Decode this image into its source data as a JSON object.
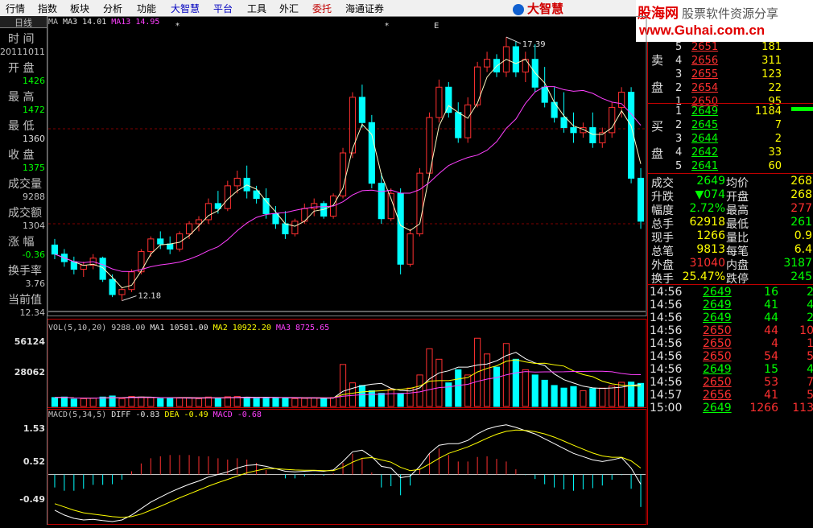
{
  "menu": {
    "items": [
      "行情",
      "指数",
      "板块",
      "分析",
      "功能",
      "大智慧",
      "平台",
      "工具",
      "外汇",
      "委托",
      "海通证券"
    ],
    "logo_text": "大智慧"
  },
  "watermark": {
    "line1_brand": "股海网",
    "line1_slogan": "股票软件资源分享",
    "line2": "www.Guhai.com.cn"
  },
  "left_panel": {
    "tab": "日线",
    "rows": [
      {
        "label": "时  间",
        "value": "20111011",
        "color": "#c0c0c0"
      },
      {
        "label": "开  盘",
        "value": "1426",
        "color": "#00ff00"
      },
      {
        "label": "最  高",
        "value": "1472",
        "color": "#00ff00"
      },
      {
        "label": "最  低",
        "value": "1360",
        "color": "#e0e0e0"
      },
      {
        "label": "收  盘",
        "value": "1375",
        "color": "#00ff00"
      },
      {
        "label": "成交量",
        "value": "9288",
        "color": "#c0c0c0"
      },
      {
        "label": "成交额",
        "value": "1304",
        "color": "#c0c0c0"
      },
      {
        "label": "涨  幅",
        "value": "-0.36",
        "color": "#00ff00"
      },
      {
        "label": "换手率",
        "value": "3.76",
        "color": "#c0c0c0"
      },
      {
        "label": "当前值",
        "value": "12.34",
        "color": "#c0c0c0"
      }
    ]
  },
  "price_chart": {
    "legend": [
      {
        "text": "MA",
        "color": "#c0c0c0"
      },
      {
        "text": "MA3 14.01",
        "color": "#e0e0e0"
      },
      {
        "text": "MA13 14.95",
        "color": "#ff40ff"
      }
    ],
    "high_label": "17.39",
    "low_label": "12.18",
    "markers": [
      "*",
      "*",
      "E"
    ]
  },
  "volume_chart": {
    "legend": [
      {
        "text": "VOL(5,10,20)",
        "color": "#c0c0c0"
      },
      {
        "text": "9288.00",
        "color": "#c0c0c0"
      },
      {
        "text": "MA1 10581.00",
        "color": "#e0e0e0"
      },
      {
        "text": "MA2 10922.20",
        "color": "#ffff00"
      },
      {
        "text": "MA3 8725.65",
        "color": "#ff40ff"
      }
    ],
    "y_ticks": [
      "56124",
      "28062"
    ]
  },
  "macd_chart": {
    "legend": [
      {
        "text": "MACD(5,34,5)",
        "color": "#c0c0c0"
      },
      {
        "text": "DIFF -0.83",
        "color": "#e0e0e0"
      },
      {
        "text": "DEA -0.49",
        "color": "#ffff00"
      },
      {
        "text": "MACD -0.68",
        "color": "#ff40ff"
      }
    ],
    "y_ticks": [
      "1.53",
      "0.52",
      "-0.49"
    ]
  },
  "order_book": {
    "sell_label": [
      "卖",
      "盘"
    ],
    "buy_label": [
      "买",
      "盘"
    ],
    "sell": [
      {
        "level": "5",
        "price": "2651",
        "volume": "181"
      },
      {
        "level": "4",
        "price": "2656",
        "volume": "311"
      },
      {
        "level": "3",
        "price": "2655",
        "volume": "123"
      },
      {
        "level": "2",
        "price": "2654",
        "volume": "22"
      },
      {
        "level": "1",
        "price": "2650",
        "volume": "95"
      }
    ],
    "buy": [
      {
        "level": "1",
        "price": "2649",
        "volume": "1184"
      },
      {
        "level": "2",
        "price": "2645",
        "volume": "7"
      },
      {
        "level": "3",
        "price": "2644",
        "volume": "2"
      },
      {
        "level": "4",
        "price": "2642",
        "volume": "33"
      },
      {
        "level": "5",
        "price": "2641",
        "volume": "60"
      }
    ]
  },
  "stats": [
    {
      "l1": "成交",
      "v1": "2649",
      "v1c": "#00ff00",
      "l2": "均价",
      "v2": "268",
      "v2c": "#ffff00"
    },
    {
      "l1": "升跌",
      "v1": "▼074",
      "v1c": "#00ff00",
      "l2": "开盘",
      "v2": "268",
      "v2c": "#ffff00"
    },
    {
      "l1": "幅度",
      "v1": "2.72%",
      "v1c": "#00ff00",
      "l2": "最高",
      "v2": "277",
      "v2c": "#ff3030"
    },
    {
      "l1": "总手",
      "v1": "62918",
      "v1c": "#ffff00",
      "l2": "最低",
      "v2": "261",
      "v2c": "#00ff00"
    },
    {
      "l1": "现手",
      "v1": "1266",
      "v1c": "#ffff00",
      "l2": "量比",
      "v2": "0.9",
      "v2c": "#ffff00"
    },
    {
      "l1": "总笔",
      "v1": "9813",
      "v1c": "#ffff00",
      "l2": "每笔",
      "v2": "6.4",
      "v2c": "#ffff00"
    },
    {
      "l1": "外盘",
      "v1": "31040",
      "v1c": "#ff3030",
      "l2": "内盘",
      "v2": "3187",
      "v2c": "#00ff00"
    },
    {
      "l1": "换手",
      "v1": "25.47%",
      "v1c": "#ffff00",
      "l2": "跌停",
      "v2": "245",
      "v2c": "#00ff00"
    }
  ],
  "ticks": [
    {
      "time": "14:56",
      "price": "2649",
      "vol": "16",
      "n": "2",
      "vc": "#00ff00"
    },
    {
      "time": "14:56",
      "price": "2649",
      "vol": "41",
      "n": "4",
      "vc": "#00ff00"
    },
    {
      "time": "14:56",
      "price": "2649",
      "vol": "44",
      "n": "2",
      "vc": "#00ff00"
    },
    {
      "time": "14:56",
      "price": "2650",
      "vol": "44",
      "n": "10",
      "vc": "#ff3030"
    },
    {
      "time": "14:56",
      "price": "2650",
      "vol": "4",
      "n": "1",
      "vc": "#ff3030"
    },
    {
      "time": "14:56",
      "price": "2650",
      "vol": "54",
      "n": "5",
      "vc": "#ff3030"
    },
    {
      "time": "14:56",
      "price": "2649",
      "vol": "15",
      "n": "4",
      "vc": "#00ff00"
    },
    {
      "time": "14:56",
      "price": "2650",
      "vol": "53",
      "n": "7",
      "vc": "#ff3030"
    },
    {
      "time": "14:57",
      "price": "2656",
      "vol": "41",
      "n": "5",
      "vc": "#ff3030"
    },
    {
      "time": "15:00",
      "price": "2649",
      "vol": "1266",
      "n": "113",
      "vc": "#ff3030"
    }
  ],
  "colors": {
    "up": "#ff3030",
    "down": "#00ffff",
    "ma_short": "#ffffff",
    "ma_mid": "#ffff00",
    "ma_long": "#ff40ff",
    "grid": "#800000"
  },
  "chart_data": {
    "type": "candlestick",
    "count": 62,
    "ohlc": [
      [
        13.28,
        13.4,
        13.0,
        13.1
      ],
      [
        13.1,
        13.2,
        12.85,
        12.95
      ],
      [
        12.95,
        13.05,
        12.7,
        12.8
      ],
      [
        12.8,
        12.95,
        12.65,
        12.88
      ],
      [
        12.88,
        13.1,
        12.8,
        13.02
      ],
      [
        13.02,
        13.05,
        12.55,
        12.6
      ],
      [
        12.6,
        12.7,
        12.25,
        12.3
      ],
      [
        12.3,
        12.45,
        12.18,
        12.4
      ],
      [
        12.4,
        12.8,
        12.35,
        12.75
      ],
      [
        12.75,
        13.2,
        12.7,
        13.15
      ],
      [
        13.15,
        13.45,
        13.05,
        13.4
      ],
      [
        13.4,
        13.55,
        13.2,
        13.3
      ],
      [
        13.3,
        13.45,
        13.1,
        13.2
      ],
      [
        13.2,
        13.55,
        13.15,
        13.5
      ],
      [
        13.5,
        13.75,
        13.4,
        13.7
      ],
      [
        13.7,
        13.85,
        13.55,
        13.78
      ],
      [
        13.78,
        14.2,
        13.7,
        14.1
      ],
      [
        14.1,
        14.35,
        13.9,
        14.0
      ],
      [
        14.0,
        14.55,
        13.95,
        14.45
      ],
      [
        14.45,
        14.75,
        14.3,
        14.6
      ],
      [
        14.6,
        14.85,
        14.2,
        14.35
      ],
      [
        14.35,
        14.45,
        14.1,
        14.2
      ],
      [
        14.2,
        14.4,
        13.8,
        13.9
      ],
      [
        13.9,
        14.05,
        13.6,
        13.7
      ],
      [
        13.7,
        13.95,
        13.4,
        13.5
      ],
      [
        13.5,
        13.8,
        13.45,
        13.75
      ],
      [
        13.75,
        14.1,
        13.7,
        14.0
      ],
      [
        14.0,
        14.2,
        13.85,
        14.1
      ],
      [
        14.1,
        14.15,
        13.8,
        13.85
      ],
      [
        13.85,
        14.3,
        13.8,
        14.25
      ],
      [
        14.25,
        15.2,
        14.2,
        15.1
      ],
      [
        15.1,
        16.3,
        15.0,
        16.2
      ],
      [
        16.2,
        16.45,
        15.6,
        15.7
      ],
      [
        15.7,
        15.85,
        14.4,
        14.5
      ],
      [
        14.5,
        14.7,
        13.7,
        13.8
      ],
      [
        13.8,
        14.4,
        13.75,
        14.3
      ],
      [
        14.3,
        14.4,
        12.7,
        12.9
      ],
      [
        12.9,
        13.6,
        12.85,
        13.5
      ],
      [
        13.5,
        14.8,
        13.45,
        14.7
      ],
      [
        14.7,
        15.9,
        14.6,
        15.8
      ],
      [
        15.8,
        16.55,
        15.7,
        16.4
      ],
      [
        16.4,
        16.5,
        15.8,
        15.9
      ],
      [
        15.9,
        16.1,
        15.3,
        15.4
      ],
      [
        15.4,
        16.2,
        15.3,
        16.05
      ],
      [
        16.05,
        16.9,
        16.0,
        16.8
      ],
      [
        16.8,
        17.1,
        16.7,
        16.95
      ],
      [
        16.95,
        17.05,
        16.6,
        16.7
      ],
      [
        16.7,
        17.39,
        16.6,
        17.2
      ],
      [
        17.2,
        17.3,
        16.6,
        16.7
      ],
      [
        16.7,
        17.1,
        16.5,
        16.95
      ],
      [
        16.95,
        17.25,
        16.3,
        16.4
      ],
      [
        16.4,
        16.8,
        16.0,
        16.1
      ],
      [
        16.1,
        16.4,
        15.7,
        15.8
      ],
      [
        15.8,
        16.3,
        15.5,
        15.6
      ],
      [
        15.6,
        15.9,
        15.3,
        15.5
      ],
      [
        15.5,
        15.7,
        15.4,
        15.6
      ],
      [
        15.6,
        15.9,
        15.2,
        15.3
      ],
      [
        15.3,
        15.6,
        15.2,
        15.5
      ],
      [
        15.5,
        16.1,
        15.4,
        16.0
      ],
      [
        16.0,
        16.4,
        15.8,
        16.3
      ],
      [
        16.3,
        16.4,
        14.5,
        14.6
      ],
      [
        14.6,
        14.8,
        13.6,
        13.75
      ]
    ],
    "volume": [
      3400,
      3600,
      2800,
      3000,
      3200,
      3600,
      4000,
      3000,
      3800,
      3600,
      3400,
      3000,
      3100,
      3200,
      3300,
      3000,
      3600,
      3200,
      3700,
      3800,
      3500,
      3300,
      3300,
      3400,
      3200,
      3000,
      3100,
      3200,
      3100,
      3400,
      16000,
      9000,
      8000,
      6000,
      5000,
      6500,
      5000,
      7000,
      12000,
      22000,
      18000,
      9000,
      14000,
      12000,
      26000,
      20000,
      15000,
      24000,
      18000,
      14000,
      12000,
      10000,
      8000,
      7000,
      7600,
      6000,
      6800,
      7000,
      7800,
      9200,
      9288,
      8800
    ],
    "macd": {
      "diff": [
        -1.1,
        -1.25,
        -1.35,
        -1.4,
        -1.38,
        -1.42,
        -1.45,
        -1.4,
        -1.25,
        -1.05,
        -0.85,
        -0.7,
        -0.55,
        -0.42,
        -0.3,
        -0.2,
        -0.08,
        0.0,
        0.08,
        0.2,
        0.28,
        0.3,
        0.25,
        0.18,
        0.1,
        0.08,
        0.1,
        0.12,
        0.1,
        0.14,
        0.4,
        0.7,
        0.75,
        0.55,
        0.25,
        0.2,
        -0.1,
        -0.05,
        0.25,
        0.65,
        0.9,
        0.95,
        0.95,
        1.05,
        1.25,
        1.4,
        1.48,
        1.53,
        1.45,
        1.35,
        1.25,
        1.1,
        0.95,
        0.8,
        0.65,
        0.55,
        0.45,
        0.4,
        0.45,
        0.52,
        0.2,
        -0.3
      ],
      "dea": [
        -0.9,
        -1.0,
        -1.1,
        -1.18,
        -1.22,
        -1.26,
        -1.3,
        -1.32,
        -1.3,
        -1.22,
        -1.1,
        -0.98,
        -0.85,
        -0.72,
        -0.6,
        -0.48,
        -0.36,
        -0.25,
        -0.15,
        -0.05,
        0.05,
        0.12,
        0.18,
        0.18,
        0.16,
        0.14,
        0.13,
        0.13,
        0.12,
        0.12,
        0.22,
        0.38,
        0.5,
        0.52,
        0.45,
        0.38,
        0.22,
        0.12,
        0.16,
        0.32,
        0.5,
        0.65,
        0.75,
        0.85,
        0.98,
        1.12,
        1.24,
        1.33,
        1.37,
        1.36,
        1.32,
        1.25,
        1.15,
        1.03,
        0.9,
        0.78,
        0.66,
        0.57,
        0.53,
        0.53,
        0.42,
        0.2
      ],
      "ylim": [
        -1.5,
        1.6
      ]
    }
  }
}
